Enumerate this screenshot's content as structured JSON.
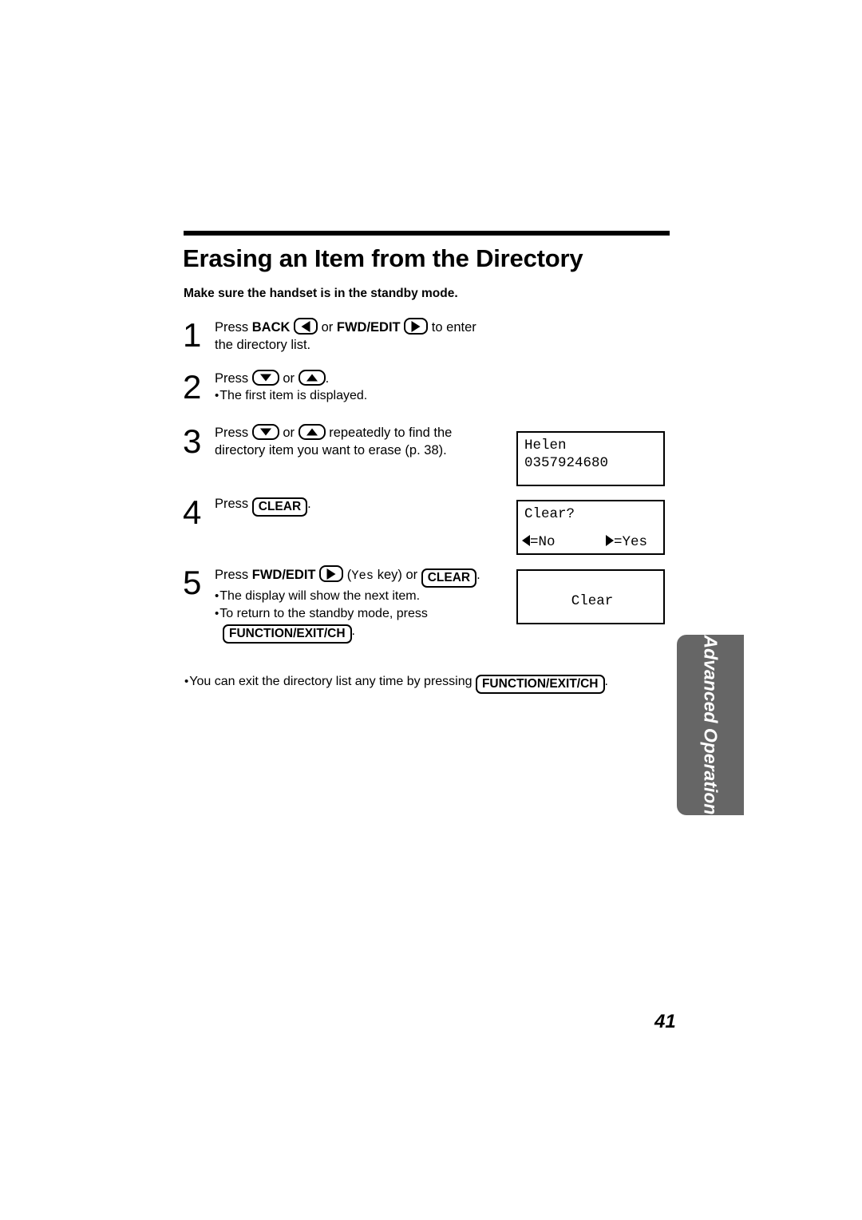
{
  "document": {
    "title": "Erasing an Item from the Directory",
    "subtitle": "Make sure the handset is in the standby mode.",
    "page_number": "41",
    "side_tab_label": "Advanced Operation",
    "footer_note": {
      "text_before": "You can exit the directory list any time by pressing ",
      "key": "FUNCTION/EXIT/CH",
      "text_after": "."
    }
  },
  "steps": [
    {
      "number": "1",
      "press_label": "Press ",
      "key_name_1": "BACK",
      "icon_1": "arrow-left-key-icon",
      "middle": " or ",
      "key_name_2": "FWD/EDIT",
      "icon_2": "arrow-right-key-icon",
      "tail": " to enter",
      "line2": "the directory list."
    },
    {
      "number": "2",
      "press_label": "Press ",
      "icon_1": "arrow-down-key-icon",
      "middle": " or ",
      "icon_2": "arrow-up-key-icon",
      "tail": ".",
      "bullets": [
        "The first item is displayed."
      ]
    },
    {
      "number": "3",
      "press_label": "Press ",
      "icon_1": "arrow-down-key-icon",
      "middle": " or ",
      "icon_2": "arrow-up-key-icon",
      "tail": " repeatedly to find the",
      "line2": "directory item you want to erase (p. 38)."
    },
    {
      "number": "4",
      "press_label": "Press ",
      "key": "CLEAR",
      "tail": "."
    },
    {
      "number": "5",
      "press_label": "Press ",
      "key_name_1": "FWD/EDIT",
      "icon_1": "arrow-right-key-icon",
      "paren_open": " (",
      "mono_word": "Yes",
      "paren_mid": " key) or ",
      "key": "CLEAR",
      "tail": ".",
      "bullets": [
        "The display will show the next item.",
        "To return to the standby mode, press"
      ],
      "bullet_cont_key": "FUNCTION/EXIT/CH",
      "bullet_cont_tail": "."
    }
  ],
  "displays": [
    {
      "name": "directory-entry-display",
      "line1": "Helen",
      "line2": "0357924680"
    },
    {
      "name": "clear-confirm-display",
      "line1": "Clear?",
      "left_icon": "arrow-left-icon",
      "left_label": "=No",
      "right_icon": "arrow-right-icon",
      "right_label": "=Yes"
    },
    {
      "name": "clear-result-display",
      "line1": "Clear"
    }
  ]
}
